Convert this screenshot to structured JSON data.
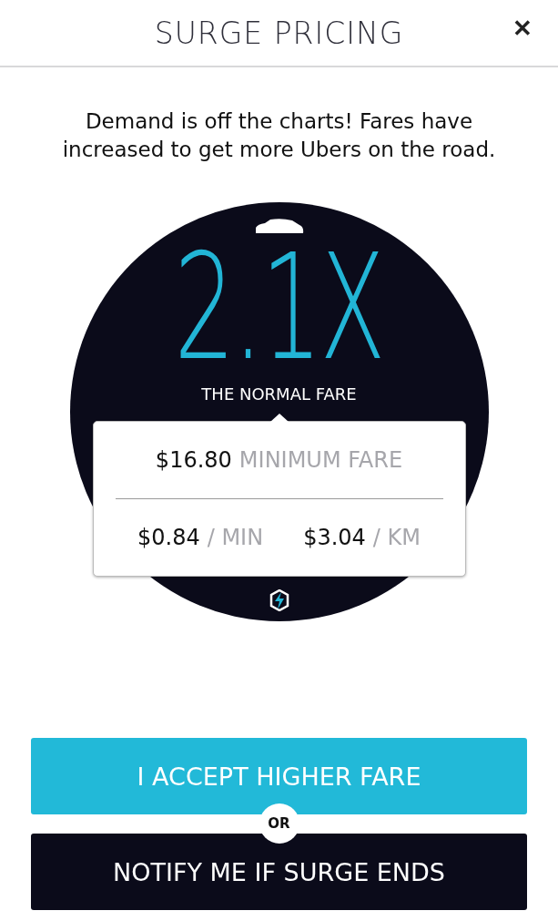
{
  "header": {
    "title": "SURGE PRICING",
    "close": "✕"
  },
  "message": "Demand is off the charts! Fares have increased to get more Ubers on the road.",
  "surge": {
    "multiplier": "2.1X",
    "caption": "THE NORMAL FARE"
  },
  "fare_card": {
    "minimum": {
      "amount": "$16.80",
      "label": "MINIMUM FARE"
    },
    "rates": [
      {
        "amount": "$0.84",
        "unit": "/ MIN"
      },
      {
        "amount": "$3.04",
        "unit": "/ KM"
      }
    ]
  },
  "accept_button": "I ACCEPT HIGHER FARE",
  "separator": "OR",
  "notify_button": "NOTIFY ME IF SURGE ENDS"
}
